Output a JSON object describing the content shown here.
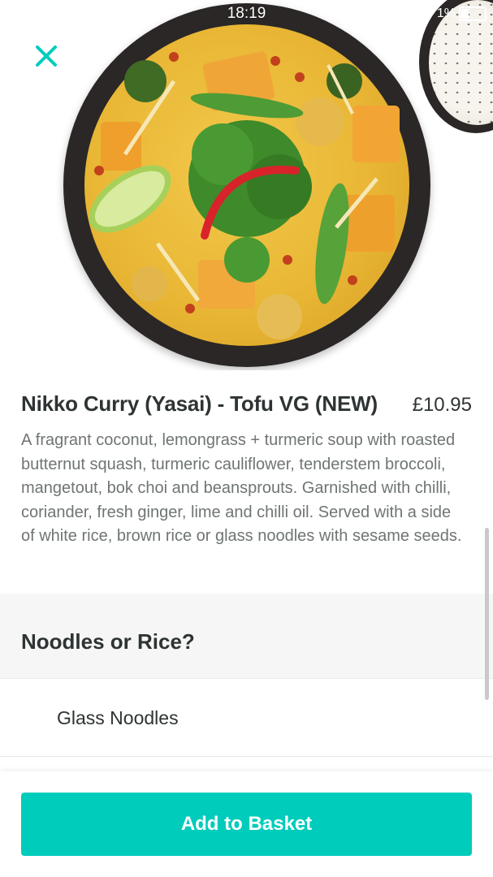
{
  "status_bar": {
    "time": "18:19",
    "battery_text": "1%"
  },
  "item": {
    "name": "Nikko Curry (Yasai) - Tofu VG (NEW)",
    "price": "£10.95",
    "description": "A fragrant coconut, lemongrass + turmeric soup with roasted butternut squash, turmeric cauliflower, tenderstem broccoli, mangetout, bok choi and beansprouts. Garnished with chilli, coriander, fresh ginger, lime and chilli oil. Served with a side of white rice, brown rice or glass noodles with sesame seeds."
  },
  "options_section": {
    "title": "Noodles or Rice?",
    "options": [
      {
        "label": "Glass Noodles"
      }
    ]
  },
  "footer": {
    "add_button_label": "Add to Basket"
  },
  "icons": {
    "close": "close-icon"
  },
  "colors": {
    "accent": "#00ccbc",
    "text_primary": "#2e3333",
    "text_secondary": "#6f7474"
  }
}
